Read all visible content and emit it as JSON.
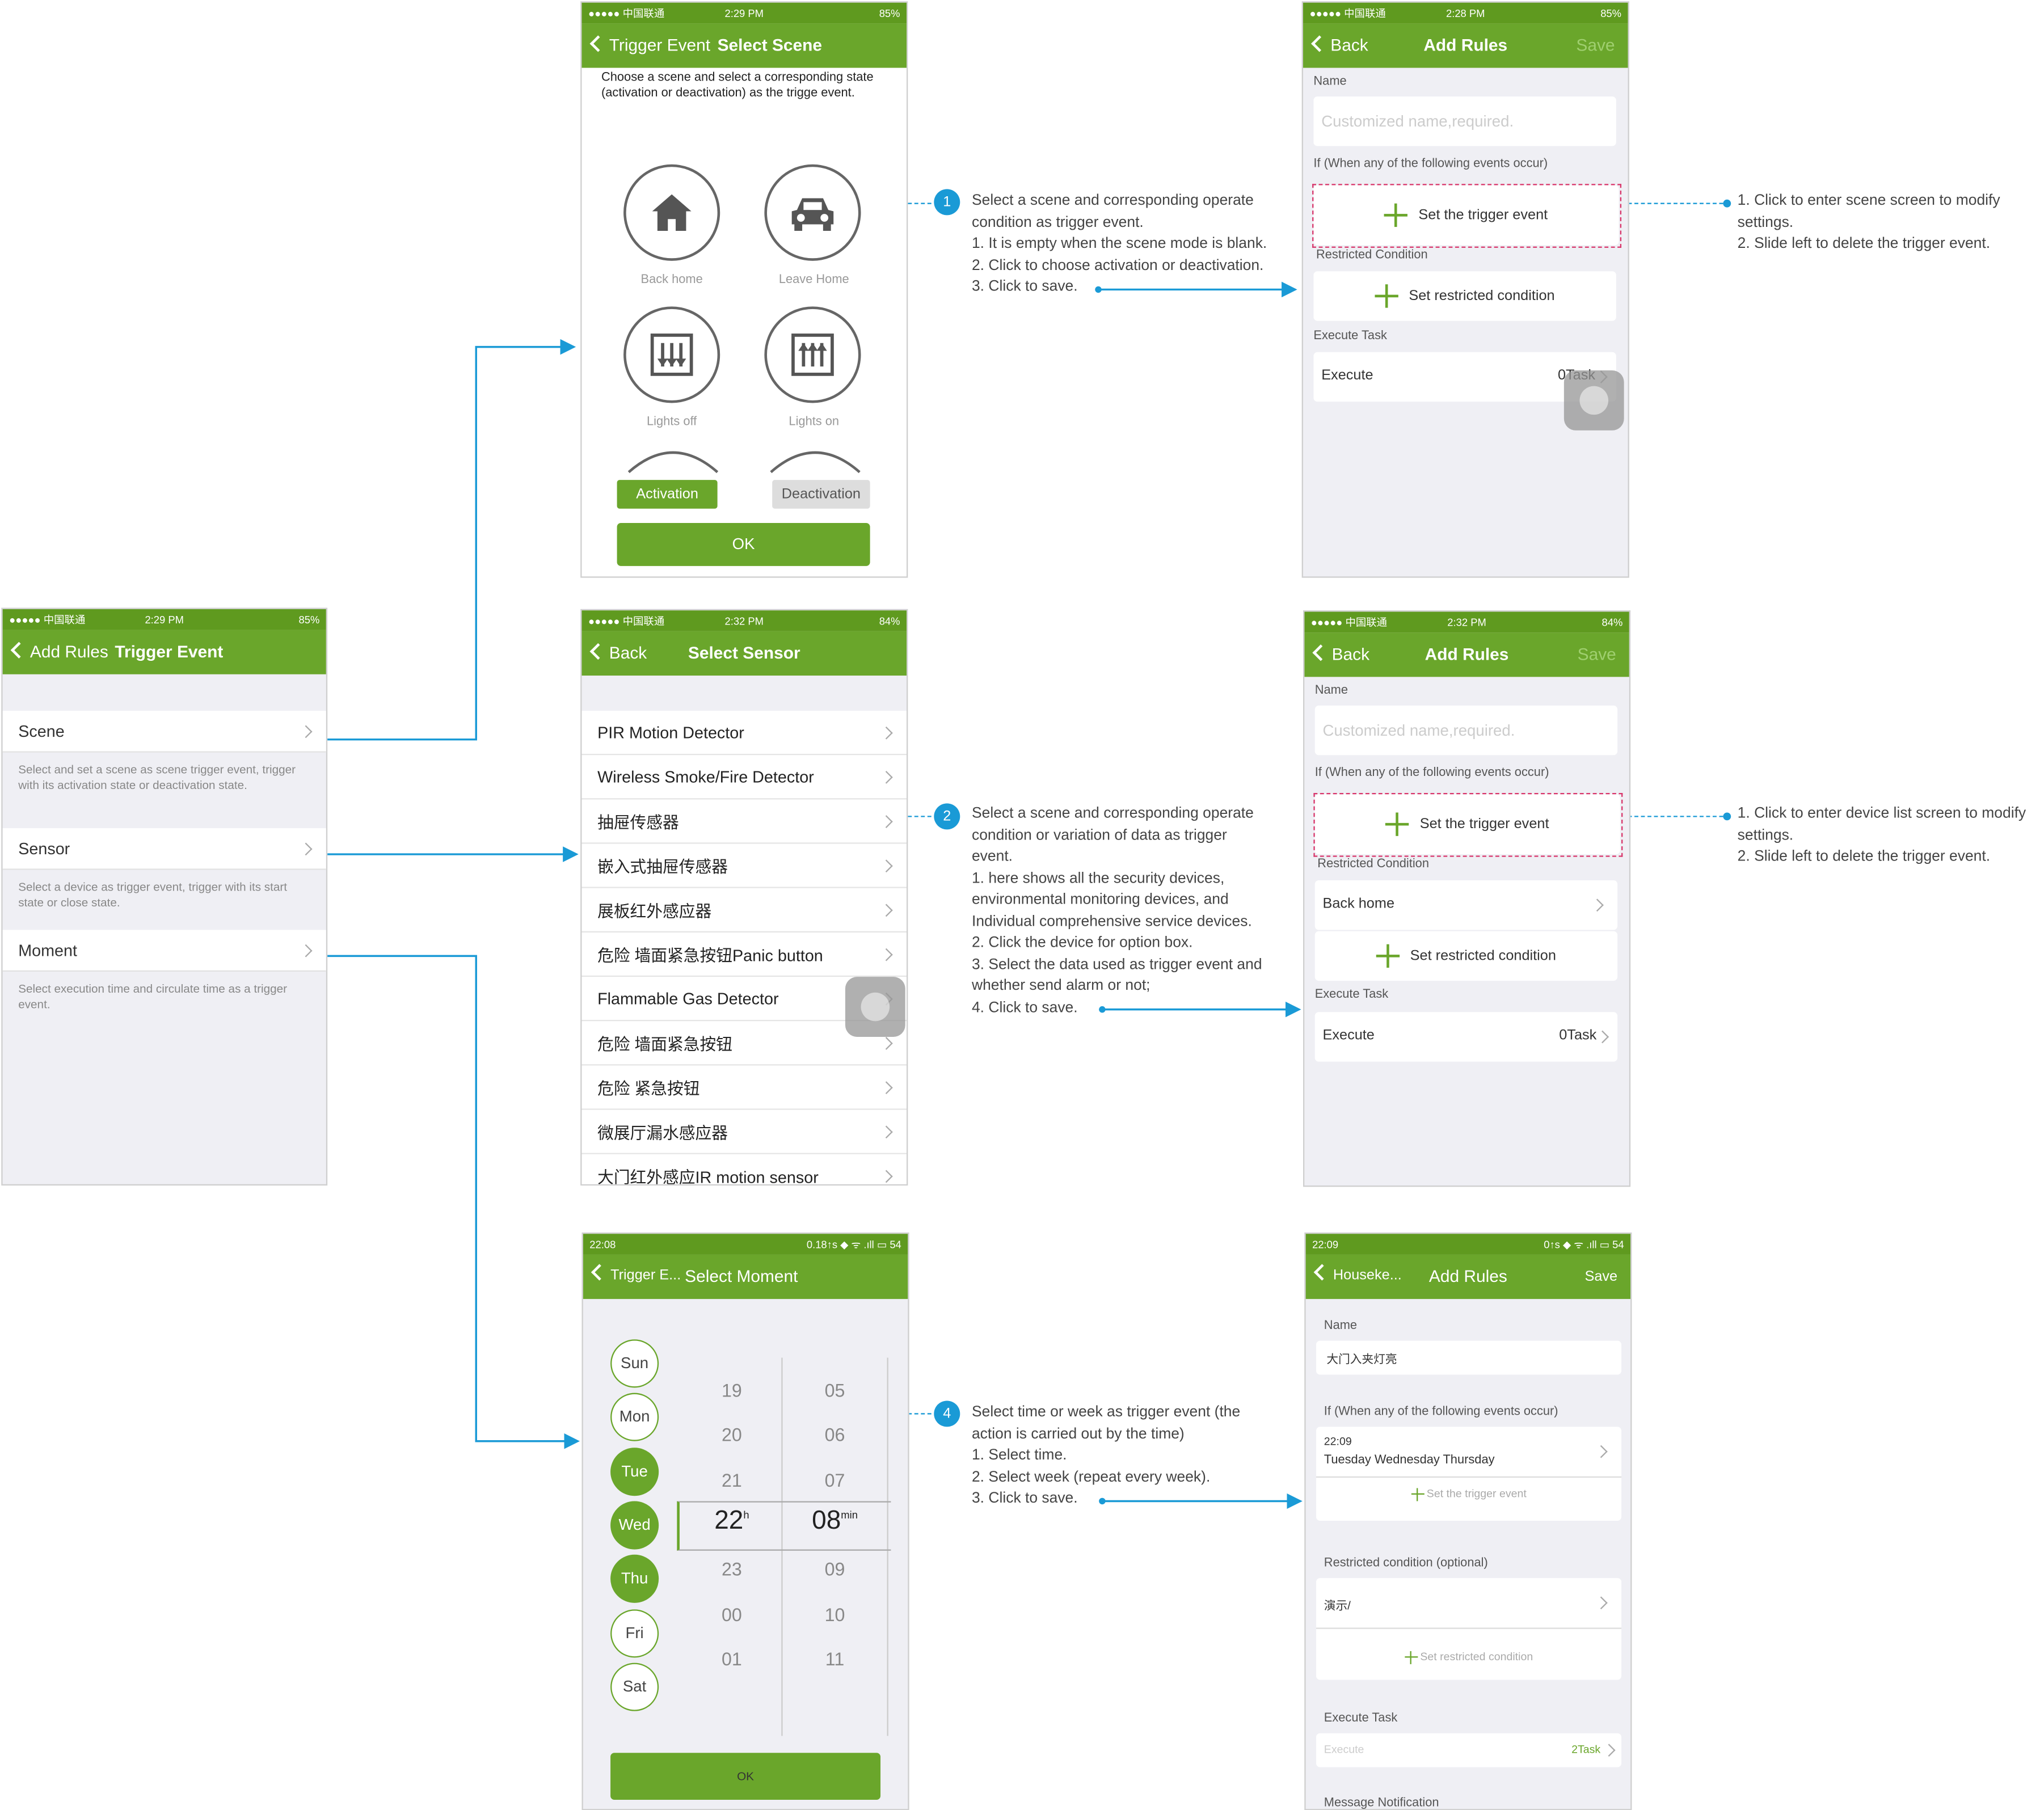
{
  "colors": {
    "brand_green": "#6aa62b",
    "accent_blue": "#1a9ad6",
    "highlight_red": "#d8356a"
  },
  "trigger_event": {
    "status": {
      "carrier": "●●●●● 中国联通",
      "time": "2:29 PM",
      "battery": "85%"
    },
    "back": "Add Rules",
    "title": "Trigger Event",
    "items": [
      {
        "label": "Scene",
        "desc": "Select and set a scene as scene trigger event, trigger with its activation state or deactivation state."
      },
      {
        "label": "Sensor",
        "desc": "Select a device as trigger event, trigger with its start state or close state."
      },
      {
        "label": "Moment",
        "desc": "Select execution time and circulate time as a trigger event."
      }
    ]
  },
  "select_scene": {
    "status": {
      "carrier": "●●●●● 中国联通",
      "time": "2:29 PM",
      "battery": "85%"
    },
    "back": "Trigger Event",
    "title": "Select Scene",
    "intro": "Choose a scene and select a corresponding state (activation or deactivation) as the trigge event.",
    "scenes": [
      "Back home",
      "Leave Home",
      "Lights off",
      "Lights on"
    ],
    "activation": "Activation",
    "deactivation": "Deactivation",
    "ok": "OK"
  },
  "add_rules_1": {
    "status": {
      "carrier": "●●●●● 中国联通",
      "time": "2:28 PM",
      "battery": "85%"
    },
    "back": "Back",
    "title": "Add Rules",
    "save": "Save",
    "name_label": "Name",
    "name_placeholder": "Customized name,required.",
    "if_label": "If (When any of the following events occur)",
    "trigger_btn": "Set the trigger event",
    "restricted_label": "Restricted Condition",
    "restricted_btn": "Set restricted condition",
    "execute_label": "Execute Task",
    "execute": "Execute",
    "task_count": "0Task"
  },
  "select_sensor": {
    "status": {
      "carrier": "●●●●● 中国联通",
      "time": "2:32 PM",
      "battery": "84%"
    },
    "back": "Back",
    "title": "Select Sensor",
    "sensors": [
      "PIR Motion Detector",
      "Wireless Smoke/Fire Detector",
      "抽屉传感器",
      "嵌入式抽屉传感器",
      "展板红外感应器",
      "危险 墙面紧急按钮Panic button",
      "Flammable Gas Detector",
      "危险 墙面紧急按钮",
      "危险 紧急按钮",
      "微展厅漏水感应器",
      "大门红外感应IR motion sensor"
    ]
  },
  "add_rules_2": {
    "status": {
      "carrier": "●●●●● 中国联通",
      "time": "2:32 PM",
      "battery": "84%"
    },
    "back": "Back",
    "title": "Add Rules",
    "save": "Save",
    "name_label": "Name",
    "name_placeholder": "Customized name,required.",
    "if_label": "If (When any of the following events occur)",
    "trigger_btn": "Set the trigger event",
    "restricted_label": "Restricted Condition",
    "restricted_item": "Back home",
    "restricted_btn": "Set restricted condition",
    "execute_label": "Execute Task",
    "execute": "Execute",
    "task_count": "0Task"
  },
  "select_moment": {
    "status": {
      "time": "22:08",
      "right": "0.18↑s  ◆  ᯤ .ıll ▭ 54"
    },
    "back": "Trigger E...",
    "title": "Select Moment",
    "days": [
      "Sun",
      "Mon",
      "Tue",
      "Wed",
      "Thu",
      "Fri",
      "Sat"
    ],
    "selected_days": [
      false,
      false,
      true,
      true,
      true,
      false,
      false
    ],
    "hours": [
      "19",
      "20",
      "21",
      "22",
      "23",
      "00",
      "01"
    ],
    "minutes": [
      "05",
      "06",
      "07",
      "08",
      "09",
      "10",
      "11"
    ],
    "hour_unit": "h",
    "minute_unit": "min",
    "ok": "OK"
  },
  "add_rules_3": {
    "status": {
      "time": "22:09",
      "right": "0↑s  ◆  ᯤ .ıll ▭ 54"
    },
    "back": "Houseke...",
    "title": "Add Rules",
    "save": "Save",
    "name_label": "Name",
    "name_value": "大门入夹灯亮",
    "if_label": "If (When any of the following events occur)",
    "event_time": "22:09",
    "event_days": "Tuesday   Wednesday   Thursday",
    "trigger_btn": "Set the trigger event",
    "restricted_label": "Restricted condition (optional)",
    "restricted_item": "演示/",
    "restricted_btn": "Set restricted condition",
    "execute_label": "Execute Task",
    "execute": "Execute",
    "task_count": "2Task",
    "message_label": "Message Notification"
  },
  "annotations": {
    "scene": {
      "badge": "1",
      "lines": [
        "Select a scene and corresponding operate",
        "condition as trigger event.",
        "1. It is empty when the scene mode is blank.",
        "2. Click to choose activation or deactivation.",
        "3. Click to save."
      ]
    },
    "scene_right": [
      "1. Click to enter scene screen to modify",
      "settings.",
      "2. Slide left to delete the trigger event."
    ],
    "sensor": {
      "badge": "2",
      "lines": [
        "Select a scene and corresponding operate",
        "condition or variation of data as trigger",
        "event.",
        "1. here shows all the security devices,",
        "environmental monitoring devices, and",
        "Individual comprehensive service devices.",
        "2. Click the device for option box.",
        "3. Select the data used as trigger event and",
        "whether send alarm or not;",
        "4. Click to save."
      ]
    },
    "sensor_right": [
      "1. Click to enter device list screen to modify",
      "settings.",
      "2. Slide left to delete the trigger event."
    ],
    "moment": {
      "badge": "4",
      "lines": [
        "Select time or week as trigger event (the",
        "action is carried out by the time)",
        "1. Select time.",
        "2. Select week (repeat every week).",
        "3. Click to save."
      ]
    }
  }
}
